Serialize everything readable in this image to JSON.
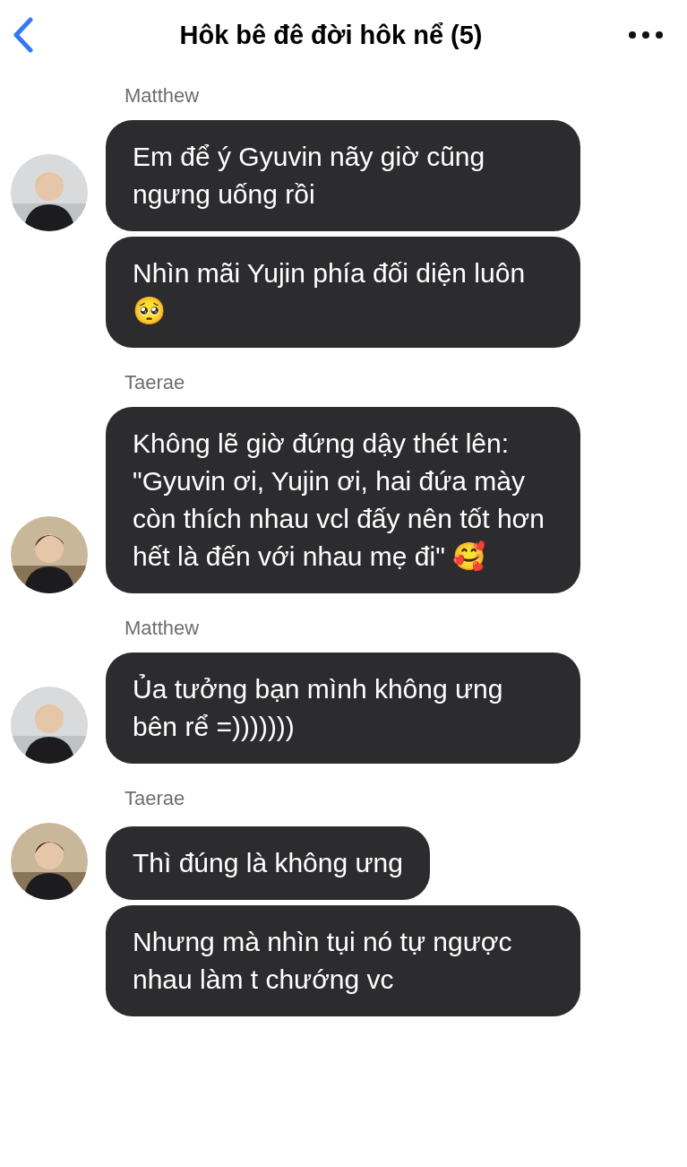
{
  "header": {
    "title": "Hôk bê đê đời hôk nể (5)"
  },
  "groups": [
    {
      "sender": "Matthew",
      "messages": [
        "Em để ý Gyuvin nãy giờ cũng ngưng uống rồi",
        "Nhìn mãi Yujin phía đối diện luôn 🥺"
      ]
    },
    {
      "sender": "Taerae",
      "messages": [
        "Không lẽ giờ đứng dậy thét lên: \"Gyuvin ơi, Yujin ơi, hai đứa mày còn thích nhau vcl đấy nên tốt hơn hết là đến với nhau mẹ đi\" 🥰"
      ]
    },
    {
      "sender": "Matthew",
      "messages": [
        "Ủa tưởng bạn mình không ưng bên rể =)))))))"
      ]
    },
    {
      "sender": "Taerae",
      "messages": [
        "Thì đúng là không ưng",
        "Nhưng mà nhìn tụi nó tự ngược nhau làm t chướng vc"
      ]
    }
  ]
}
